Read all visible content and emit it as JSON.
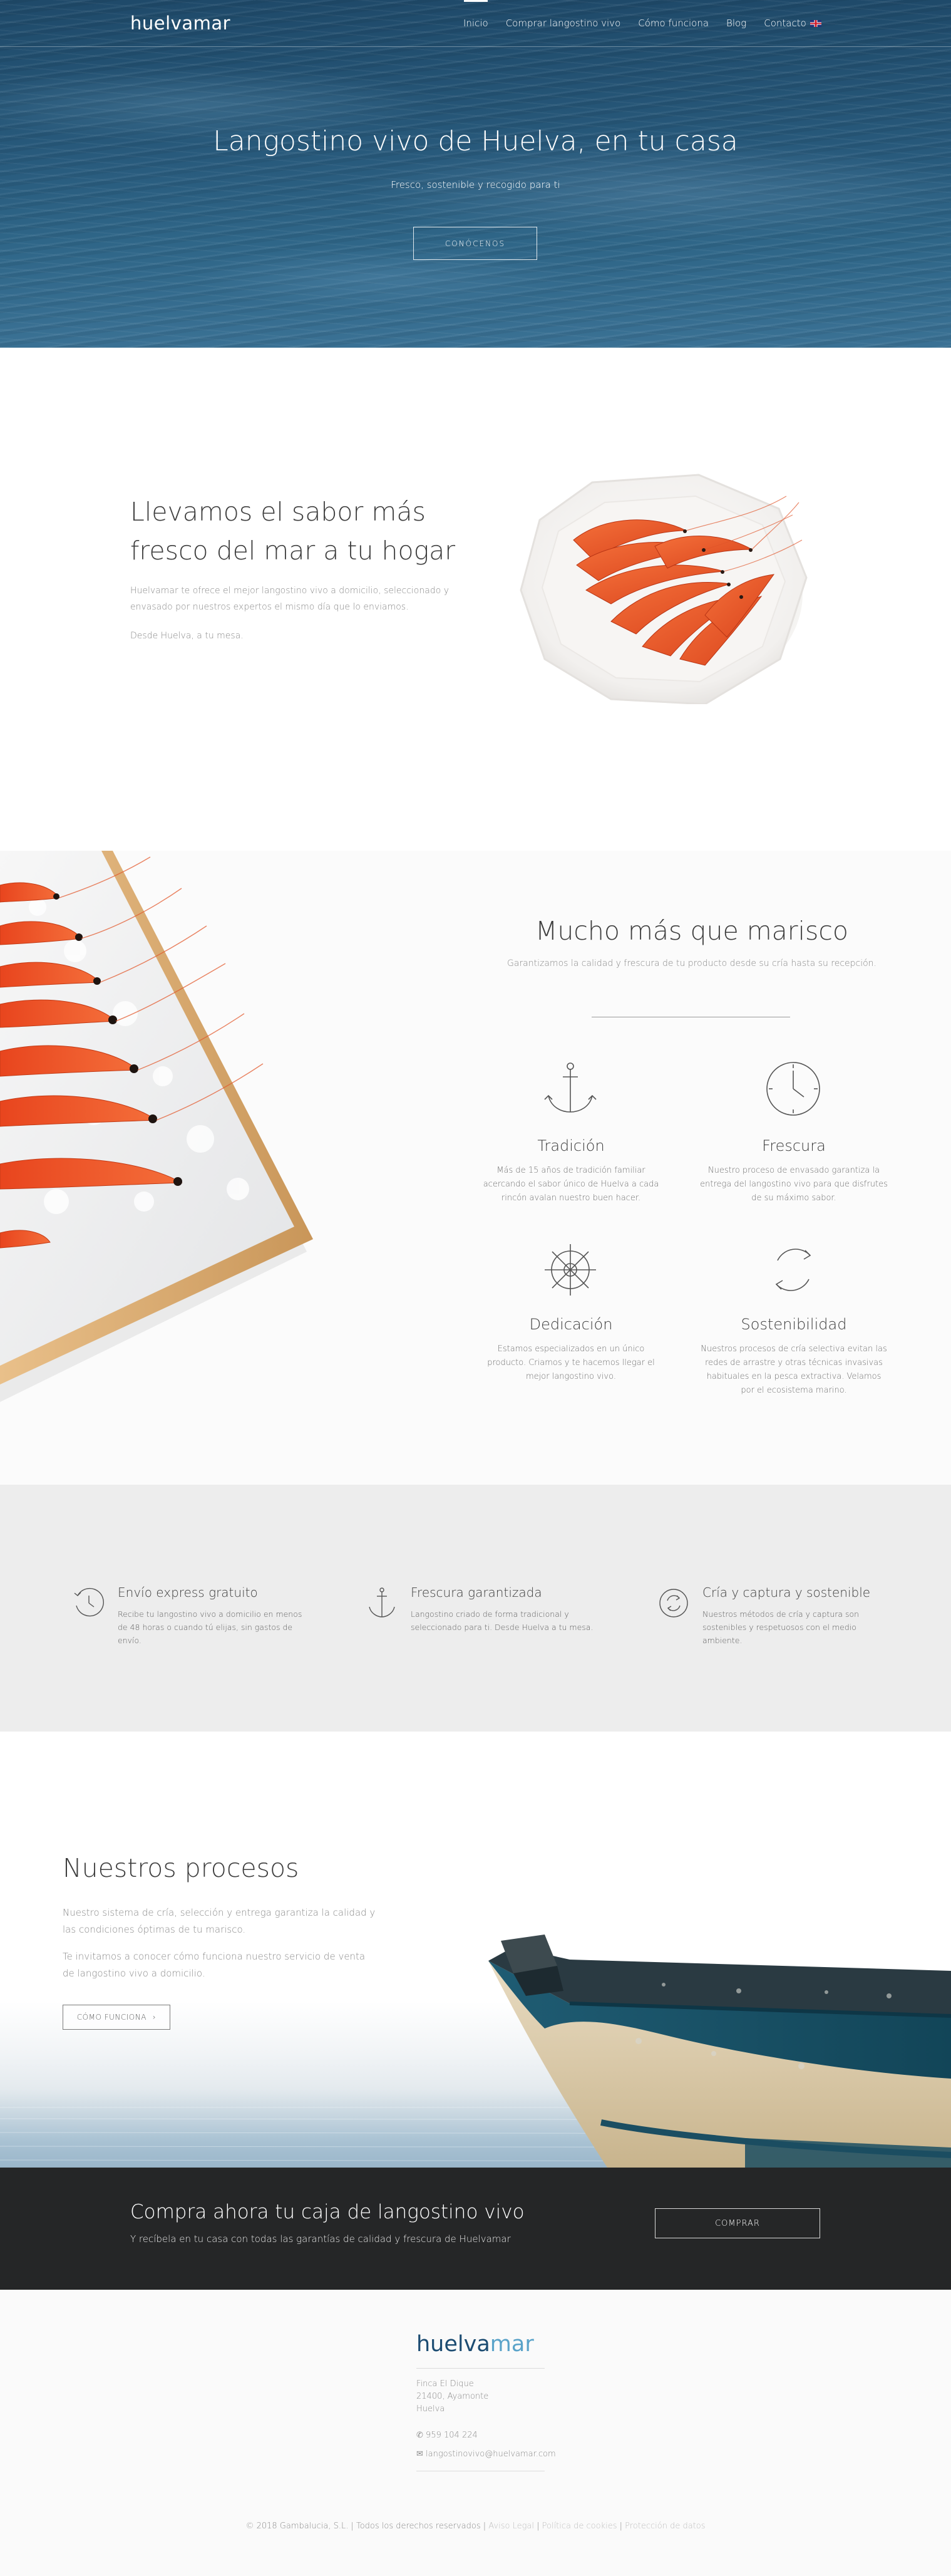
{
  "nav": {
    "logo": "huelvamar",
    "links": [
      "Inicio",
      "Comprar langostino vivo",
      "Cómo funciona",
      "Blog",
      "Contacto"
    ],
    "language_flag": "uk-flag-icon"
  },
  "hero": {
    "title": "Langostino vivo de Huelva, en tu casa",
    "subtitle": "Fresco, sostenible y recogido para ti",
    "button": "CONÓCENOS"
  },
  "intro": {
    "title_line1": "Llevamos el sabor más",
    "title_line2": "fresco del mar a tu hogar",
    "p1": "Huelvamar te ofrece el mejor langostino vivo a domicilio, seleccionado y envasado por nuestros expertos el mismo día que lo enviamos.",
    "p2": "Desde Huelva, a tu mesa."
  },
  "marisco": {
    "title": "Mucho más que marisco",
    "subtitle": "Garantizamos la calidad y frescura de tu producto desde su cría hasta su recepción.",
    "features": [
      {
        "icon": "anchor-icon",
        "title": "Tradición",
        "text": "Más de 15 años de tradición familiar acercando el sabor único de Huelva a cada rincón avalan nuestro buen hacer."
      },
      {
        "icon": "clock-icon",
        "title": "Frescura",
        "text": "Nuestro proceso de envasado garantiza la entrega del langostino vivo para que disfrutes de su máximo sabor."
      },
      {
        "icon": "ship-wheel-icon",
        "title": "Dedicación",
        "text": "Estamos especializados en un único producto. Criamos y te hacemos llegar el mejor langostino vivo."
      },
      {
        "icon": "recycle-icon",
        "title": "Sostenibilidad",
        "text": "Nuestros procesos de cría selectiva evitan las redes de arrastre y otras técnicas invasivas habituales en la pesca extractiva. Velamos por el ecosistema marino."
      }
    ]
  },
  "benefits": [
    {
      "icon": "clock-icon",
      "title": "Envío express gratuito",
      "text": "Recibe tu langostino vivo a domicilio en menos de 48 horas o cuando tú elijas, sin gastos de envío."
    },
    {
      "icon": "anchor-icon",
      "title": "Frescura garantizada",
      "text": "Langostino criado de forma tradicional y seleccionado para ti. Desde Huelva a tu mesa."
    },
    {
      "icon": "recycle-icon",
      "title": "Cría y captura y sostenible",
      "text": "Nuestros métodos de cría y captura son sostenibles y respetuosos con el medio ambiente."
    }
  ],
  "procesos": {
    "title": "Nuestros procesos",
    "p1": "Nuestro sistema de cría, selección y entrega garantiza la calidad y las condiciones óptimas de tu marisco.",
    "p2": "Te invitamos a conocer cómo funciona nuestro servicio de venta de langostino vivo a domicilio.",
    "button": "CÓMO FUNCIONA",
    "button_arrow": "›"
  },
  "cta": {
    "title": "Compra ahora tu caja de langostino vivo",
    "subtitle": "Y recíbela en tu casa con todas las garantías de calidad y frescura de Huelvamar",
    "button": "COMPRAR"
  },
  "footer": {
    "logo_part1": "huelva",
    "logo_part2": "mar",
    "address": [
      "Finca El Dique",
      "21400, Ayamonte",
      "Huelva"
    ],
    "phone": "959 104 224",
    "email": "langostinovivo@huelvamar.com",
    "copyright": "© 2018 Gambalucia, S.L. | Todos los derechos reservados |",
    "links": [
      "Aviso Legal",
      "Política de cookies",
      "Protección de datos"
    ],
    "separator": "|",
    "colors": {
      "logo_dark": "#1c4c72",
      "logo_light": "#5aa3c9"
    }
  }
}
